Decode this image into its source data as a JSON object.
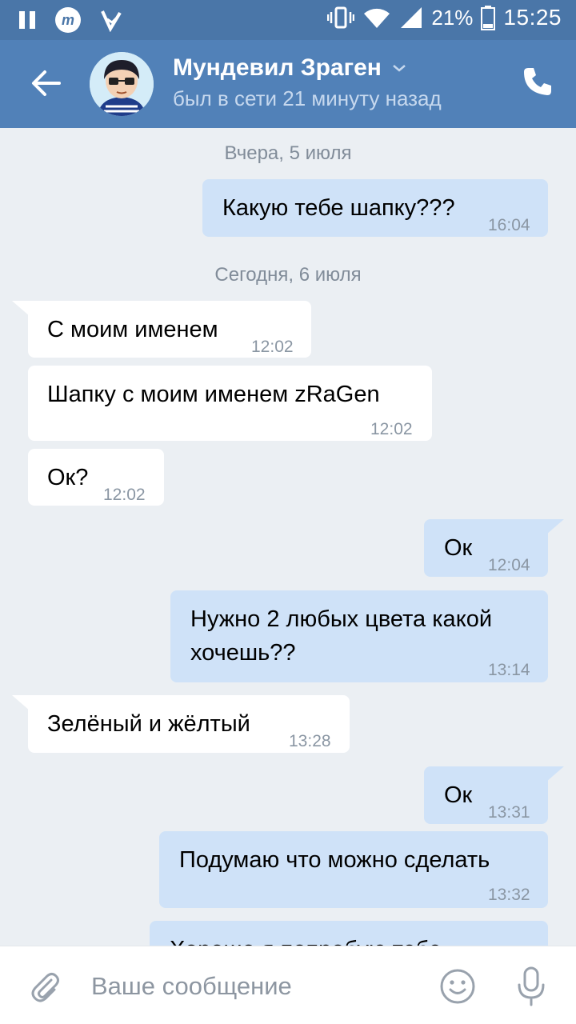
{
  "status_bar": {
    "battery_percent": "21%",
    "time": "15:25",
    "icons": [
      "pause-icon",
      "app-m-icon",
      "check-icon",
      "vibrate-icon",
      "wifi-icon",
      "signal-icon",
      "battery-icon"
    ]
  },
  "header": {
    "contact_name": "Мундевил Зраген",
    "status": "был в сети 21 минуту назад",
    "icons": [
      "back-arrow-icon",
      "chevron-down-icon",
      "phone-icon"
    ]
  },
  "dates": {
    "yesterday": "Вчера, 5 июля",
    "today": "Сегодня, 6 июля"
  },
  "messages": [
    {
      "direction": "out",
      "text": "Какую тебе шапку???",
      "time": "16:04"
    },
    {
      "direction": "in",
      "text": "С моим именем",
      "time": "12:02"
    },
    {
      "direction": "in",
      "text": "Шапку с моим именем zRaGen",
      "time": "12:02"
    },
    {
      "direction": "in",
      "text": "Ок?",
      "time": "12:02"
    },
    {
      "direction": "out",
      "text": "Ок",
      "time": "12:04"
    },
    {
      "direction": "out",
      "text_line1": "Нужно 2 любых цвета какой",
      "text_line2": "хочешь??",
      "time": "13:14"
    },
    {
      "direction": "in",
      "text": "Зелёный и жёлтый",
      "time": "13:28"
    },
    {
      "direction": "out",
      "text": "Ок",
      "time": "13:31"
    },
    {
      "direction": "out",
      "text": "Подумаю что можно сделать",
      "time": "13:32"
    },
    {
      "direction": "out",
      "text": "Хорошо я попробую тебе",
      "time": ""
    }
  ],
  "composer": {
    "placeholder": "Ваше сообщение",
    "icons": [
      "paperclip-icon",
      "emoji-icon",
      "microphone-icon"
    ]
  },
  "colors": {
    "statusbar": "#4a76a8",
    "header": "#5181b8",
    "background": "#ebeff3",
    "outgoing_bubble": "#cfe2f8",
    "incoming_bubble": "#ffffff"
  }
}
